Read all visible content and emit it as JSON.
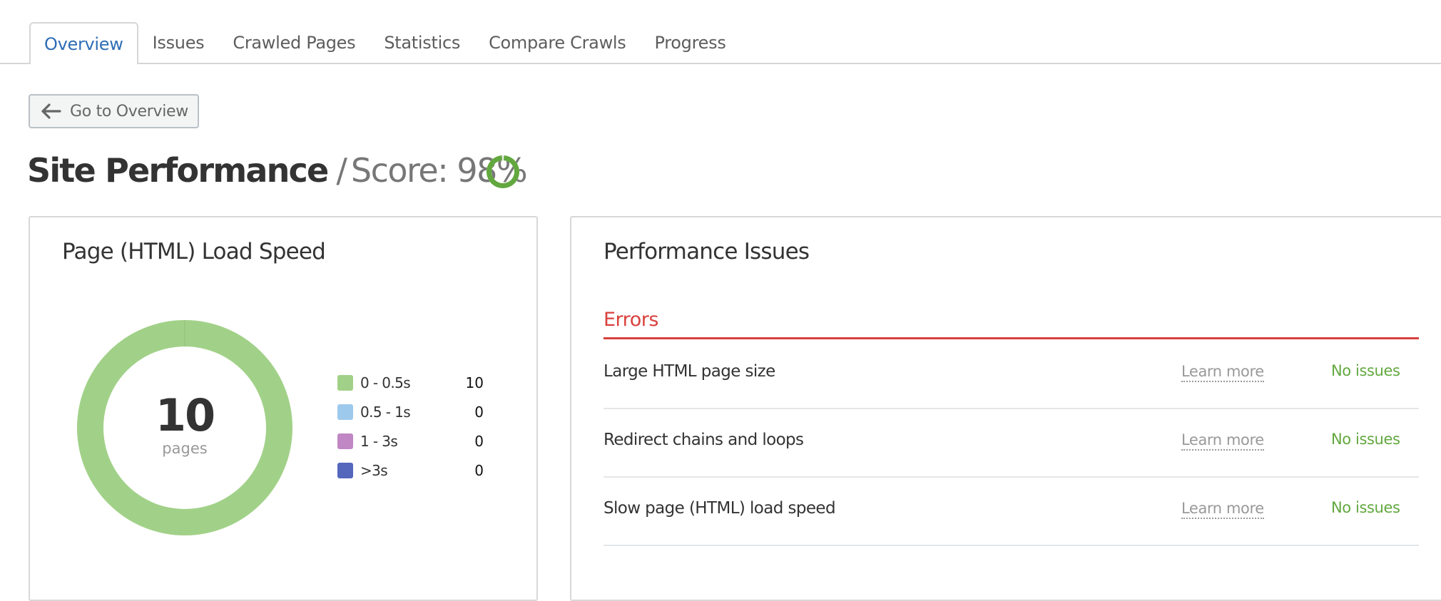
{
  "tabs": [
    {
      "label": "Overview",
      "active": true
    },
    {
      "label": "Issues",
      "active": false
    },
    {
      "label": "Crawled Pages",
      "active": false
    },
    {
      "label": "Statistics",
      "active": false
    },
    {
      "label": "Compare Crawls",
      "active": false
    },
    {
      "label": "Progress",
      "active": false
    }
  ],
  "back_button": {
    "label": "Go to Overview",
    "icon": "arrow-left-icon"
  },
  "header": {
    "title": "Site Performance",
    "separator": "/",
    "score_label": "Score: 98%",
    "score_value": 98,
    "score_icon": "score-ring-icon"
  },
  "colors": {
    "accent_blue": "#2f6db5",
    "error_red": "#d9413d",
    "success_green": "#62a83f"
  },
  "load_speed_card": {
    "title": "Page (HTML) Load Speed",
    "total": "10",
    "total_unit": "pages"
  },
  "chart_data": {
    "type": "pie",
    "title": "Page (HTML) Load Speed",
    "center_label": "10 pages",
    "donut": true,
    "legend_position": "right",
    "categories": [
      "0 - 0.5s",
      "0.5 - 1s",
      "1 - 3s",
      ">3s"
    ],
    "values": [
      10,
      0,
      0,
      0
    ],
    "value_labels": [
      "10",
      "0",
      "0",
      "0"
    ],
    "colors": [
      "#a1d188",
      "#9dc9ec",
      "#c087c4",
      "#5467bd"
    ]
  },
  "issues_card": {
    "title": "Performance Issues",
    "section": "Errors",
    "rows": [
      {
        "name": "Large HTML page size",
        "link": "Learn more",
        "status": "No issues"
      },
      {
        "name": "Redirect chains and loops",
        "link": "Learn more",
        "status": "No issues"
      },
      {
        "name": "Slow page (HTML) load speed",
        "link": "Learn more",
        "status": "No issues"
      }
    ]
  }
}
